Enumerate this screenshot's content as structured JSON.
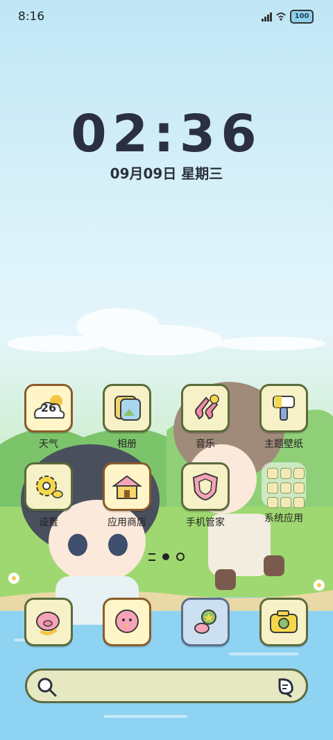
{
  "status_bar": {
    "time": "8:16",
    "battery": "100"
  },
  "lock_clock": {
    "time": "02:36",
    "date": "09月09日 星期三"
  },
  "apps_page": [
    {
      "label": "天气",
      "icon": "weather-icon"
    },
    {
      "label": "相册",
      "icon": "gallery-icon"
    },
    {
      "label": "音乐",
      "icon": "music-icon"
    },
    {
      "label": "主题壁纸",
      "icon": "theme-brush-icon"
    },
    {
      "label": "设置",
      "icon": "settings-gear-icon"
    },
    {
      "label": "应用商店",
      "icon": "app-store-house-icon"
    },
    {
      "label": "手机管家",
      "icon": "phone-manager-shield-icon"
    },
    {
      "label": "系统应用",
      "icon": "system-apps-folder-icon"
    }
  ],
  "weather_icon_text": "26",
  "page_indicator": {
    "pages": 2,
    "current": 1
  },
  "dock": [
    {
      "icon": "phone-pig-icon"
    },
    {
      "icon": "messages-chick-icon"
    },
    {
      "icon": "browser-star-icon"
    },
    {
      "icon": "camera-icon"
    }
  ],
  "search_bar": {
    "left_icon": "search-icon",
    "right_icon": "voice-assistant-icon"
  },
  "colors": {
    "tile_border": "#5a6a3c",
    "tile_bg": "#f6f1c6",
    "text": "#2b3040"
  }
}
